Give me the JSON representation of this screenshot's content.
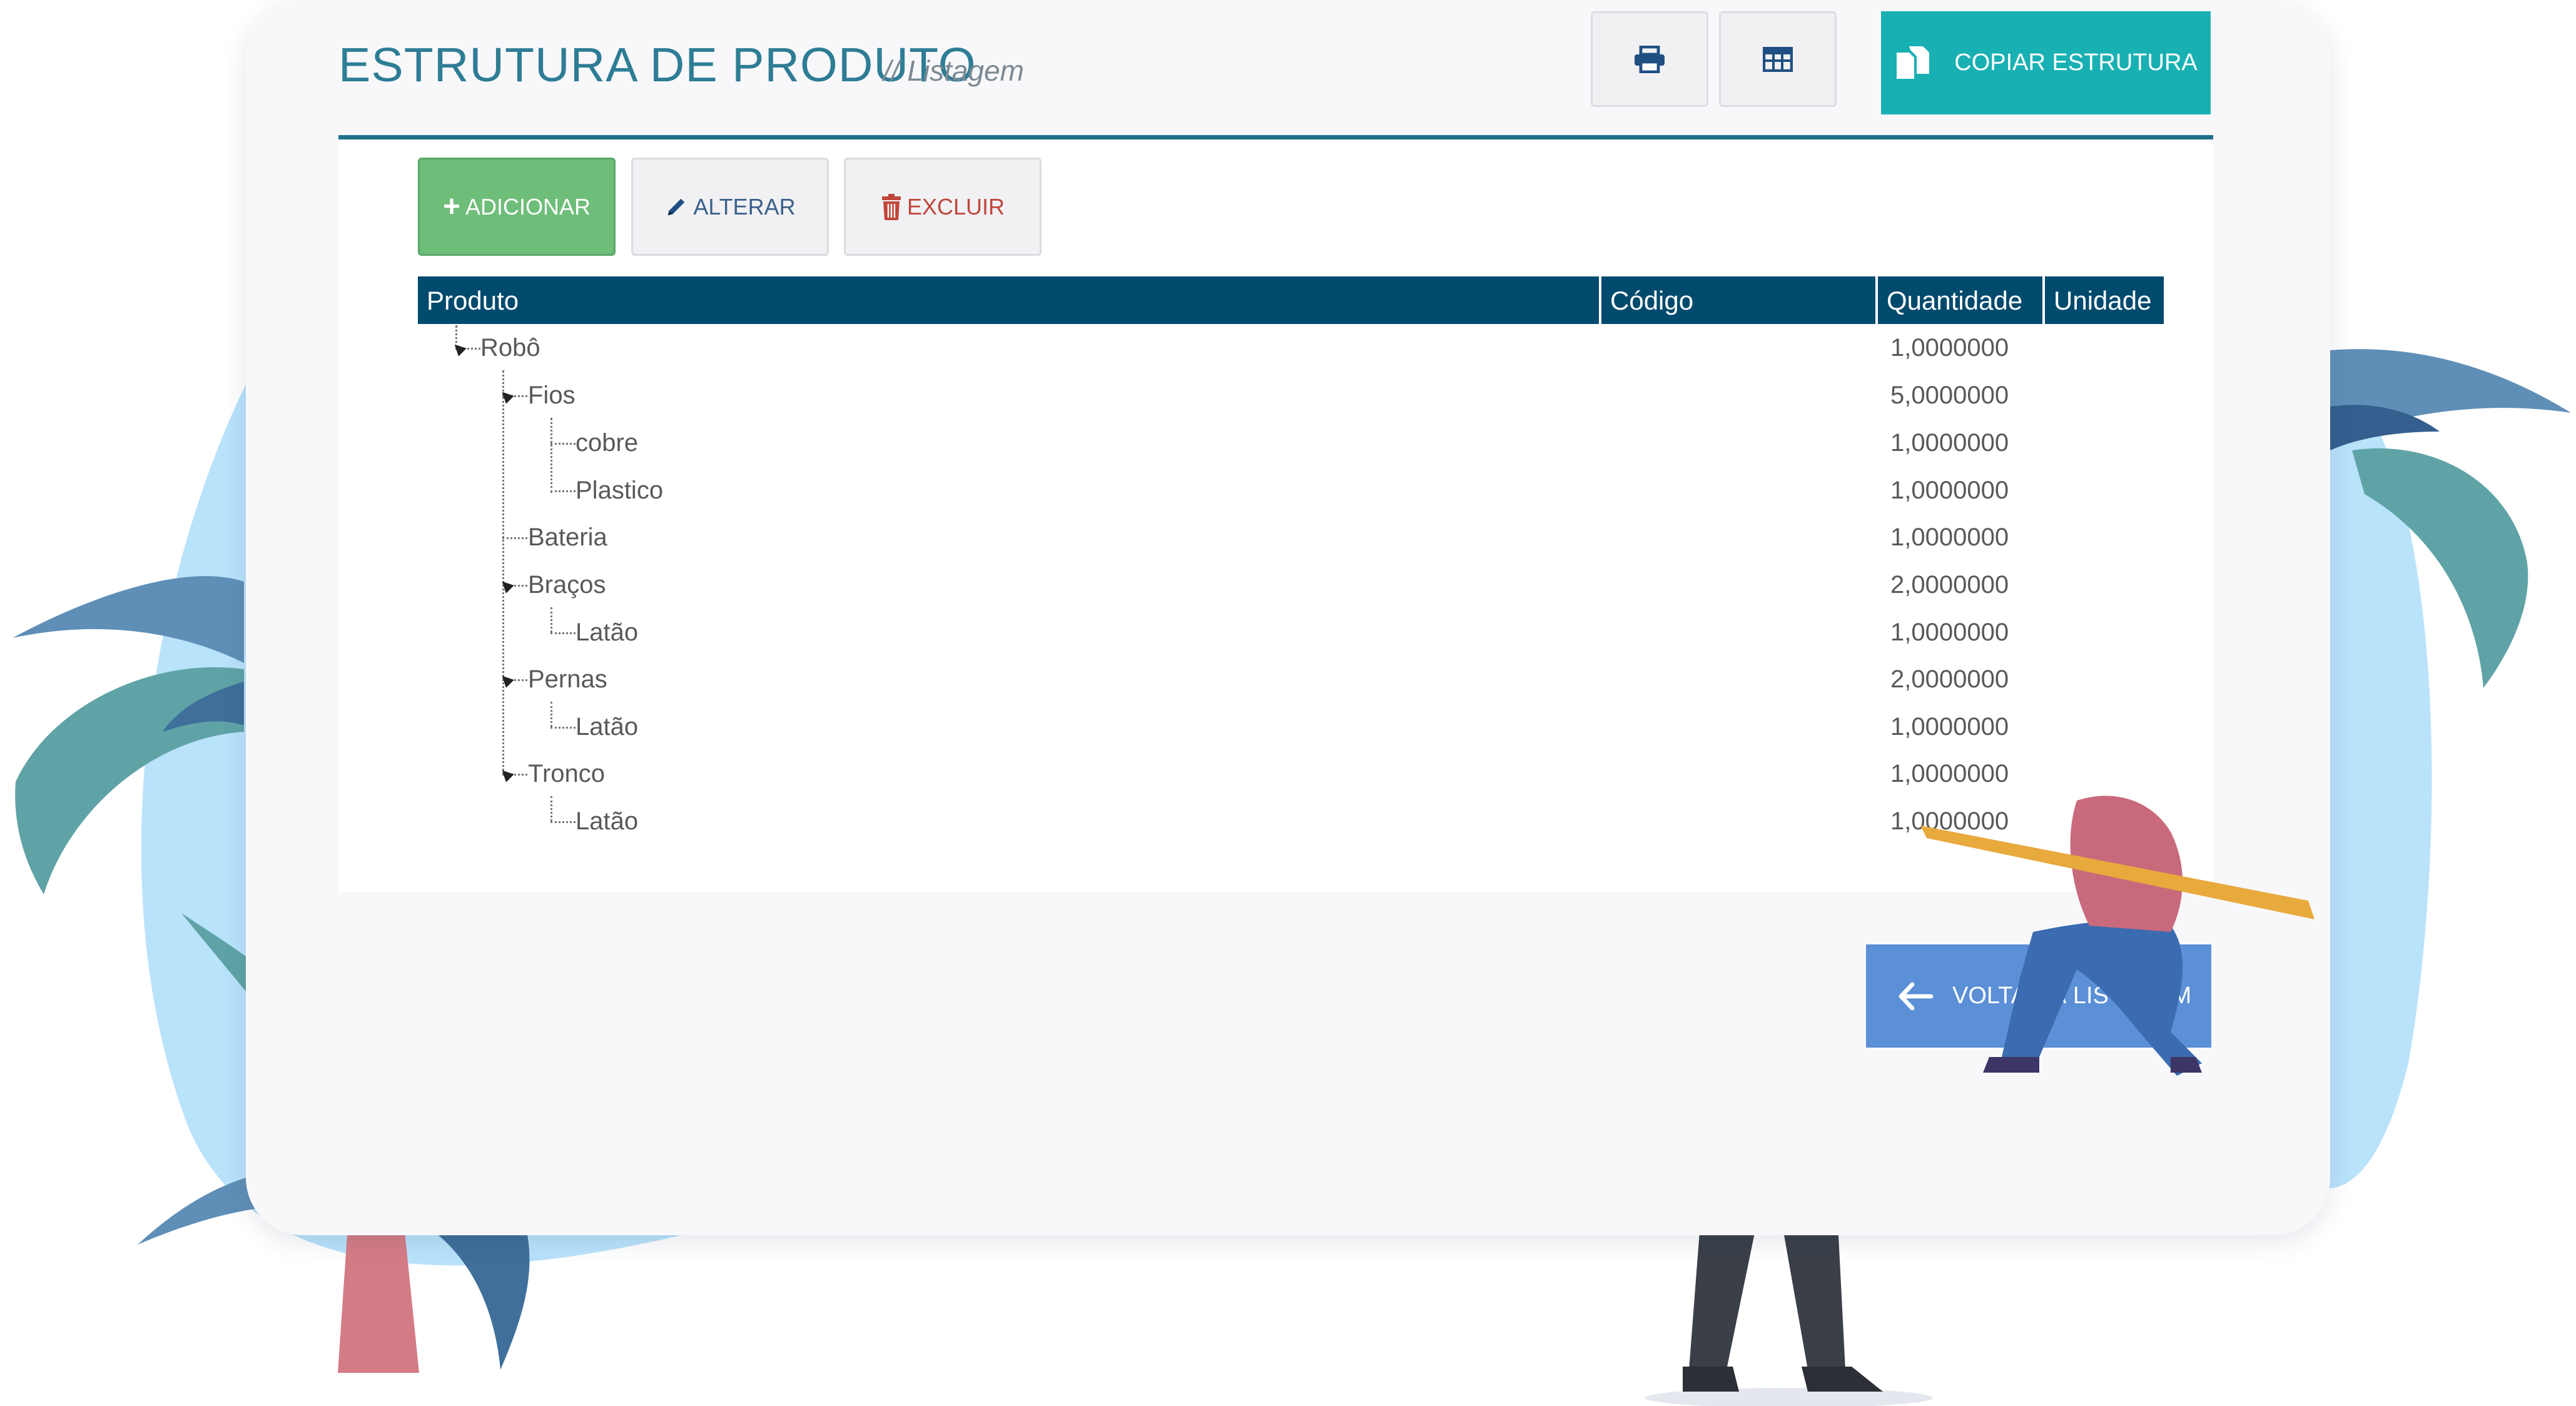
{
  "header": {
    "title": "ESTRUTURA DE PRODUTO",
    "subtitle": "// Listagem",
    "copy_label": "COPIAR ESTRUTURA"
  },
  "toolbar": {
    "add_label": "ADICIONAR",
    "edit_label": "ALTERAR",
    "delete_label": "EXCLUIR"
  },
  "table": {
    "columns": [
      "Produto",
      "Código",
      "Quantidade",
      "Unidade"
    ],
    "rows": [
      {
        "produto": "Robô",
        "quantidade": "1,0000000"
      },
      {
        "produto": "Fios",
        "quantidade": "5,0000000"
      },
      {
        "produto": "cobre",
        "quantidade": "1,0000000"
      },
      {
        "produto": "Plastico",
        "quantidade": "1,0000000"
      },
      {
        "produto": "Bateria",
        "quantidade": "1,0000000"
      },
      {
        "produto": "Braços",
        "quantidade": "2,0000000"
      },
      {
        "produto": "Latão",
        "quantidade": "1,0000000"
      },
      {
        "produto": "Pernas",
        "quantidade": "2,0000000"
      },
      {
        "produto": "Latão",
        "quantidade": "1,0000000"
      },
      {
        "produto": "Tronco",
        "quantidade": "1,0000000"
      },
      {
        "produto": "Latão",
        "quantidade": "1,0000000"
      }
    ]
  },
  "footer": {
    "back_label": "VOLTAR À LISTAGEM"
  },
  "colors": {
    "title": "#2e7d95",
    "table_header": "#004a6d",
    "add_button": "#6ebd79",
    "copy_button": "#19b0b3",
    "back_button": "#5b8fd6",
    "delete_text": "#c0463b"
  },
  "icons": [
    "printer-icon",
    "grid-icon",
    "copy-icon",
    "plus-icon",
    "pencil-icon",
    "trash-icon",
    "arrow-left-icon"
  ]
}
